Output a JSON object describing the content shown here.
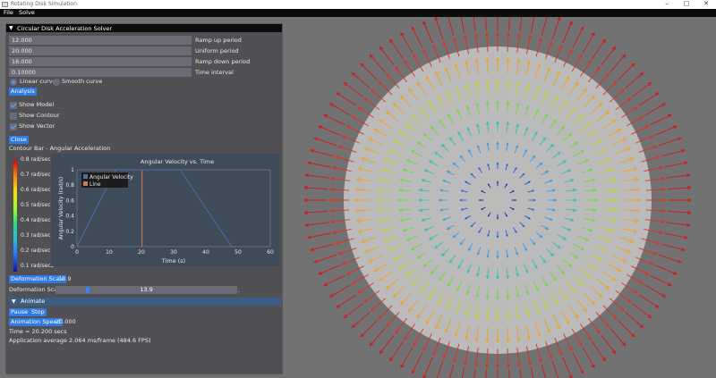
{
  "window": {
    "title": "Rotating Disk Simulation",
    "minimize": "–",
    "maximize": "□",
    "close": "✕"
  },
  "menu": [
    "File",
    "Solve"
  ],
  "panel": {
    "title": "Circular Disk Acceleration Solver",
    "fields": [
      {
        "value": "12.000",
        "label": "Ramp up period"
      },
      {
        "value": "20.000",
        "label": "Uniform period"
      },
      {
        "value": "16.000",
        "label": "Ramp down period"
      },
      {
        "value": "0.10000",
        "label": "Time interval"
      }
    ],
    "curve_options": {
      "linear": "Linear curve",
      "smooth": "Smooth curve",
      "selected": "linear"
    },
    "analysis_button": "Analysis",
    "checks": [
      {
        "label": "Show Model",
        "checked": true
      },
      {
        "label": "Show Contour",
        "checked": false
      },
      {
        "label": "Show Vector",
        "checked": true
      }
    ],
    "close_button": "Close",
    "contour_title": "Contour Bar - Angular Acceleration",
    "colorbar_labels": [
      "0.8 rad/sec2",
      "0.7 rad/sec2",
      "0.6 rad/sec2",
      "0.5 rad/sec2",
      "0.4 rad/sec2",
      "0.3 rad/sec2",
      "0.2 rad/sec2",
      "0.1 rad/sec2"
    ],
    "deformation_button": "Deformation Scale",
    "deformation_value": "13.9",
    "deformation_label": "Deformation Scale",
    "deformation_slider_value": "13.9",
    "deformation_slider_fraction": 0.17,
    "deformation_slider_suffix": ".",
    "animate_title": "Animate",
    "pause_button": "Pause",
    "stop_button": "Stop",
    "animation_speed_button": "Animation Speed",
    "animation_speed_value": "20.000",
    "time_text": "Time = 20.200 secs",
    "fps_text": "Application average 2.064 ms/frame (484.6 FPS)"
  },
  "chart_data": {
    "type": "line",
    "title": "Angular Velocity vs. Time",
    "xlabel": "Time (s)",
    "ylabel": "Angular Velocity (rad/s)",
    "xlim": [
      0,
      60
    ],
    "ylim": [
      0,
      1
    ],
    "xticks": [
      0,
      10,
      20,
      30,
      40,
      50,
      60
    ],
    "yticks": [
      0,
      0.2,
      0.4,
      0.6,
      0.8,
      1
    ],
    "legend": "top-left",
    "series": [
      {
        "name": "Angular Velocity",
        "color": "#4d6ea8",
        "x": [
          0,
          12,
          32,
          48
        ],
        "y": [
          0,
          1,
          1,
          0
        ]
      },
      {
        "name": "Line",
        "color": "#d07a55",
        "x": [
          20.2,
          20.2
        ],
        "y": [
          0,
          1
        ]
      }
    ]
  },
  "colors": {
    "accent": "#2e7be3",
    "panel_bg": "#505054",
    "disk": "#c8c8c8"
  }
}
